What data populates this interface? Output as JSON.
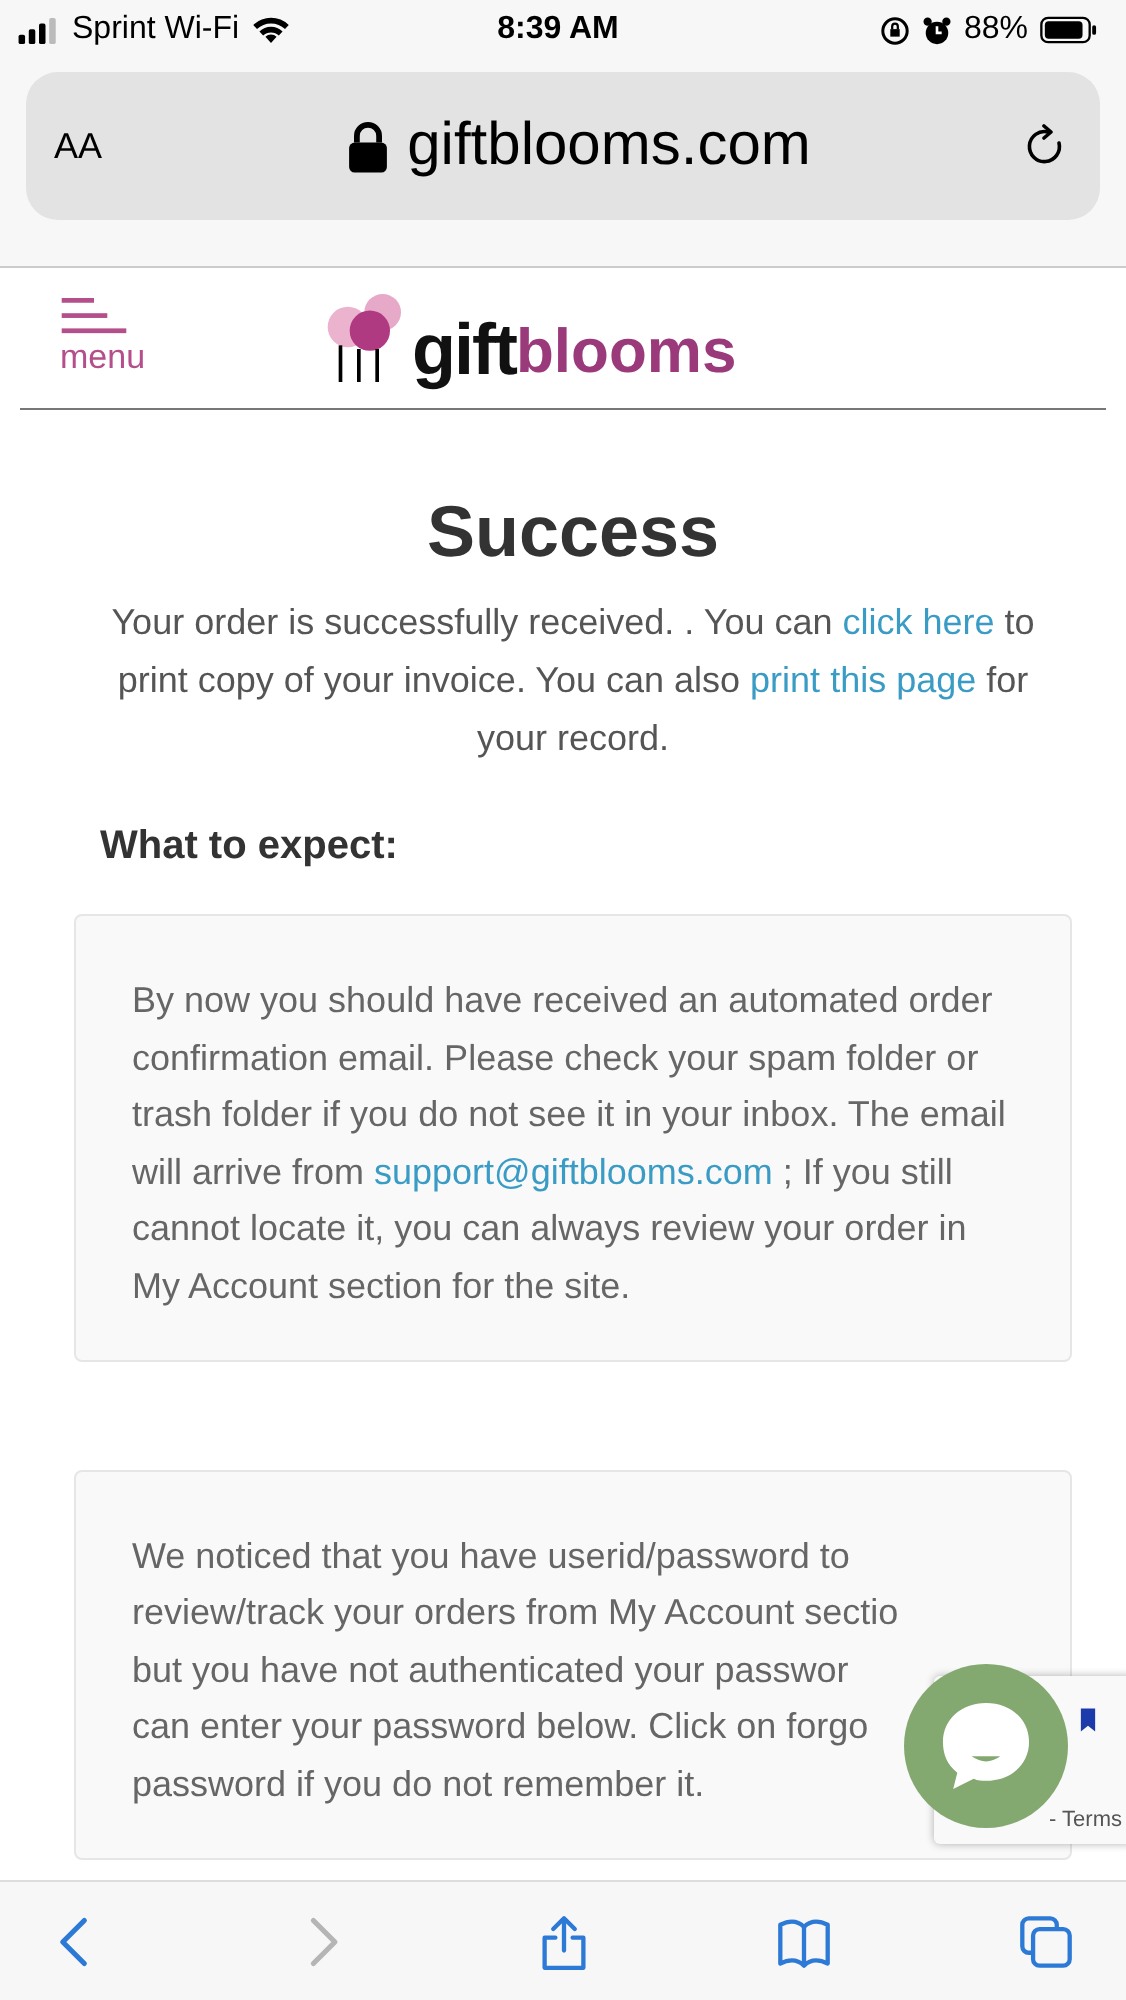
{
  "status_bar": {
    "carrier": "Sprint Wi-Fi",
    "time": "8:39 AM",
    "battery": "88%"
  },
  "address_bar": {
    "text_size": "AA",
    "url": "giftblooms.com"
  },
  "header": {
    "menu_label": "menu",
    "logo_left": "gift",
    "logo_right": "blooms"
  },
  "title": "Success",
  "intro": [
    {
      "kind": "text",
      "text": "Your order is successfully received. . You can "
    },
    {
      "kind": "link",
      "text": "click here"
    },
    {
      "kind": "text",
      "text": " to print copy of your invoice. You can also "
    },
    {
      "kind": "link",
      "text": "print this page"
    },
    {
      "kind": "text",
      "text": " for your record."
    }
  ],
  "section_heading": "What to expect:",
  "card_1": [
    {
      "kind": "text",
      "text": "By now you should have received an automated order confirmation email. Please check your spam folder or trash folder if you do not see it in your inbox. The email will arrive from "
    },
    {
      "kind": "link",
      "text": "support@giftblooms.com"
    },
    {
      "kind": "text",
      "text": " ; If you still cannot locate it, you can always review your order in My Account section for the site."
    }
  ],
  "card_2_lines": [
    "We noticed that you have userid/password to",
    "review/track your orders from My Account sectio",
    "but you have not authenticated your passwor",
    "can enter your password below. Click on forgo",
    "password if you do not remember it."
  ],
  "recaptcha": "- Terms",
  "toolbar": [
    {
      "kind": "back",
      "disabled": false
    },
    {
      "kind": "forward",
      "disabled": true
    },
    {
      "kind": "share",
      "disabled": false
    },
    {
      "kind": "bookmarks",
      "disabled": false
    },
    {
      "kind": "tabs",
      "disabled": false
    }
  ]
}
